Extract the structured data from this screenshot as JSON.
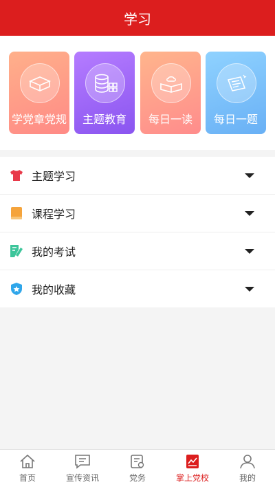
{
  "header": {
    "title": "学习"
  },
  "cards": [
    {
      "label": "学党章党规",
      "icon": "book-box-icon"
    },
    {
      "label": "主题教育",
      "icon": "database-icon"
    },
    {
      "label": "每日一读",
      "icon": "open-book-icon"
    },
    {
      "label": "每日一题",
      "icon": "tablet-icon"
    }
  ],
  "list": [
    {
      "label": "主题学习",
      "icon": "shirt-icon",
      "color": "#e83a4a"
    },
    {
      "label": "课程学习",
      "icon": "notebook-icon",
      "color": "#f5a43c"
    },
    {
      "label": "我的考试",
      "icon": "exam-pencil-icon",
      "color": "#3cc59a"
    },
    {
      "label": "我的收藏",
      "icon": "star-shield-icon",
      "color": "#2fa6ea"
    }
  ],
  "tabbar": {
    "active": 3,
    "accent": "#dc1e1e",
    "items": [
      {
        "label": "首页",
        "icon": "home-icon"
      },
      {
        "label": "宣传资讯",
        "icon": "message-icon"
      },
      {
        "label": "党务",
        "icon": "document-icon"
      },
      {
        "label": "掌上党校",
        "icon": "chart-book-icon"
      },
      {
        "label": "我的",
        "icon": "user-icon"
      }
    ]
  }
}
